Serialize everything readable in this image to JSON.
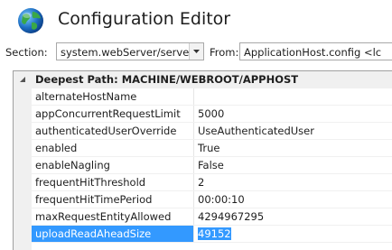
{
  "header": {
    "title": "Configuration Editor",
    "icon": "globe-icon"
  },
  "toolbar": {
    "section_label": "Section:",
    "section_value": "system.webServer/serverRu",
    "from_label": "From:",
    "from_value": "ApplicationHost.config <lc"
  },
  "grid": {
    "group_title": "Deepest Path: MACHINE/WEBROOT/APPHOST",
    "properties": [
      {
        "name": "alternateHostName",
        "value": ""
      },
      {
        "name": "appConcurrentRequestLimit",
        "value": "5000"
      },
      {
        "name": "authenticatedUserOverride",
        "value": "UseAuthenticatedUser"
      },
      {
        "name": "enabled",
        "value": "True"
      },
      {
        "name": "enableNagling",
        "value": "False"
      },
      {
        "name": "frequentHitThreshold",
        "value": "2"
      },
      {
        "name": "frequentHitTimePeriod",
        "value": "00:00:10"
      },
      {
        "name": "maxRequestEntityAllowed",
        "value": "4294967295"
      },
      {
        "name": "uploadReadAheadSize",
        "value": "49152",
        "selected": true
      }
    ]
  },
  "colors": {
    "selection": "#3399ff",
    "grid_margin": "#f0f0f0"
  }
}
